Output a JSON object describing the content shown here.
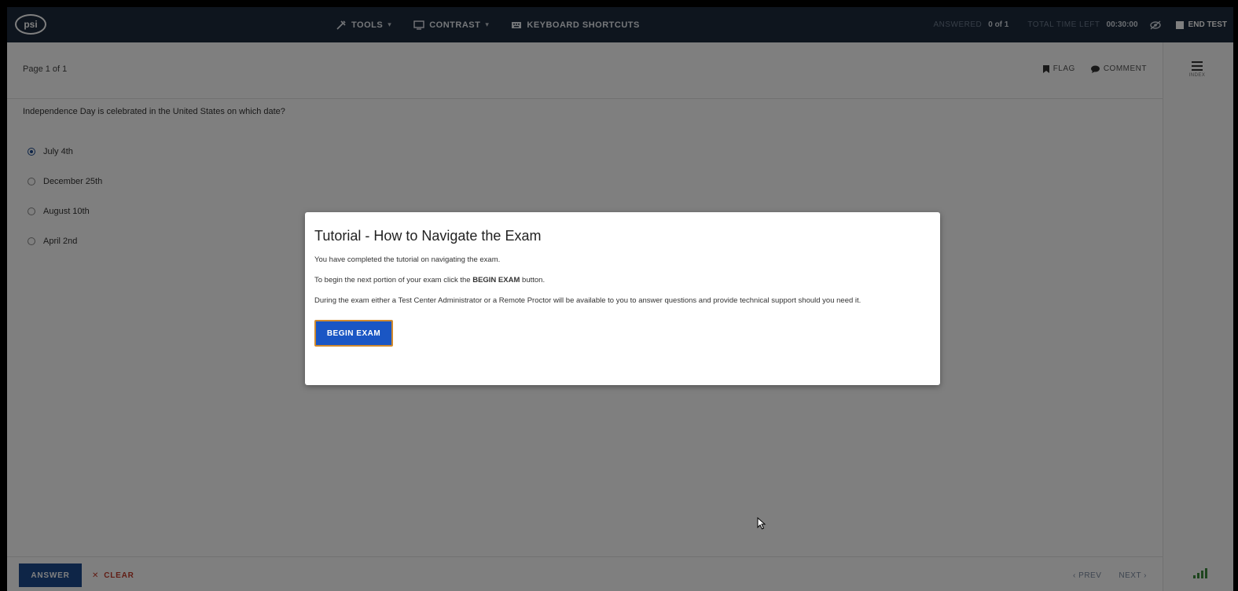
{
  "topbar": {
    "logo": "psi",
    "tools": [
      {
        "label": "TOOLS",
        "icon": "tools-icon",
        "dropdown": true
      },
      {
        "label": "CONTRAST",
        "icon": "monitor-icon",
        "dropdown": true
      },
      {
        "label": "KEYBOARD SHORTCUTS",
        "icon": "keyboard-icon",
        "dropdown": false
      }
    ],
    "answered_label": "ANSWERED",
    "answered_value": "0 of 1",
    "time_label": "TOTAL TIME LEFT",
    "time_value": "00:30:00",
    "end_test_label": "END TEST"
  },
  "page": {
    "page_label": "Page 1 of 1",
    "flag_label": "FLAG",
    "comment_label": "COMMENT"
  },
  "question": {
    "text": "Independence Day is celebrated in the United States on which date?",
    "options": [
      {
        "label": "July 4th",
        "selected": true
      },
      {
        "label": "December 25th",
        "selected": false
      },
      {
        "label": "August 10th",
        "selected": false
      },
      {
        "label": "April 2nd",
        "selected": false
      }
    ]
  },
  "bottombar": {
    "answer_label": "ANSWER",
    "clear_label": "CLEAR",
    "prev_label": "PREV",
    "next_label": "NEXT"
  },
  "sidebar": {
    "index_label": "INDEX"
  },
  "modal": {
    "title": "Tutorial - How to Navigate the Exam",
    "para1": "You have completed the tutorial on navigating the exam.",
    "para2_pre": "To begin the next portion of your exam click the ",
    "para2_bold": "BEGIN EXAM",
    "para2_post": " button.",
    "para3": "During the exam either a Test Center Administrator or a Remote Proctor will be available to you to answer questions and provide technical support should you need it.",
    "button_label": "BEGIN EXAM"
  },
  "colors": {
    "topbar_bg": "#1d2b3c",
    "primary_button": "#1d4b8f",
    "begin_button": "#1a56c4",
    "clear_red": "#c23b2a"
  }
}
